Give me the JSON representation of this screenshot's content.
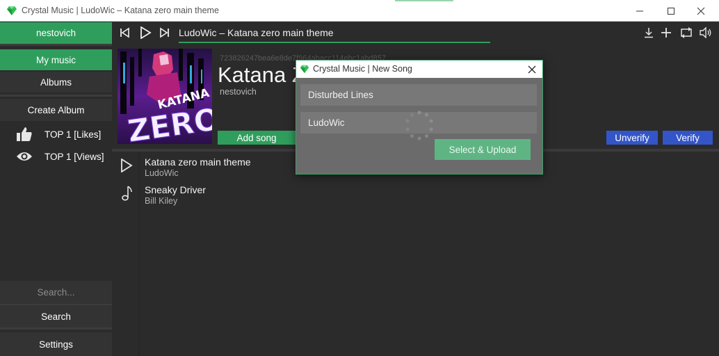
{
  "window": {
    "title": "Crystal Music | LudoWic – Katana zero main theme",
    "icon": "crystal-gem-icon",
    "controls": [
      "minimize-icon",
      "maximize-icon",
      "close-icon"
    ]
  },
  "sidebar": {
    "user": "nestovich",
    "my_music": "My music",
    "albums": "Albums",
    "create_album": "Create Album",
    "top_likes": "TOP 1 [Likes]",
    "top_views": "TOP 1 [Views]",
    "search_placeholder": "Search...",
    "search_button": "Search",
    "settings": "Settings"
  },
  "player": {
    "now_playing": "LudoWic – Katana zero main theme",
    "progress": 0.7
  },
  "album": {
    "id": "723826247bea6e8de7f964abacc114ebc1abd857",
    "title": "Katana Zero",
    "owner": "nestovich",
    "add_song": "Add song",
    "unverify": "Unverify",
    "verify": "Verify"
  },
  "songs": [
    {
      "title": "Katana zero main theme",
      "artist": "LudoWic",
      "icon": "play-icon"
    },
    {
      "title": "Sneaky Driver",
      "artist": "Bill Kiley",
      "icon": "music-note-icon"
    }
  ],
  "dialog": {
    "title": "Crystal Music | New Song",
    "field_title": "Disturbed Lines",
    "field_artist": "LudoWic",
    "upload_button": "Select & Upload"
  },
  "colors": {
    "accent_green": "#2f9e5c",
    "accent_blue": "#3355c8",
    "background": "#2b2b2b"
  }
}
